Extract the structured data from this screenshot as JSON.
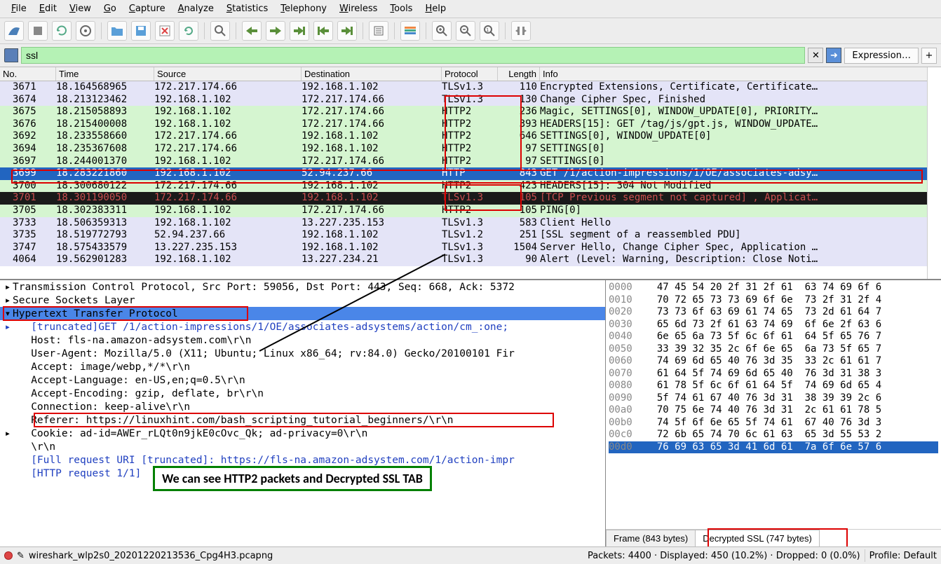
{
  "menu": [
    "File",
    "Edit",
    "View",
    "Go",
    "Capture",
    "Analyze",
    "Statistics",
    "Telephony",
    "Wireless",
    "Tools",
    "Help"
  ],
  "filter": {
    "value": "ssl",
    "expression_label": "Expression…"
  },
  "columns": {
    "no": "No.",
    "time": "Time",
    "source": "Source",
    "dest": "Destination",
    "proto": "Protocol",
    "len": "Length",
    "info": "Info"
  },
  "packets": [
    {
      "no": "3671",
      "time": "18.164568965",
      "src": "172.217.174.66",
      "dst": "192.168.1.102",
      "proto": "TLSv1.3",
      "len": "110",
      "info": "Encrypted Extensions, Certificate, Certificate…",
      "bg": "lavender"
    },
    {
      "no": "3674",
      "time": "18.213123462",
      "src": "192.168.1.102",
      "dst": "172.217.174.66",
      "proto": "TLSv1.3",
      "len": "130",
      "info": "Change Cipher Spec, Finished",
      "bg": "lavender"
    },
    {
      "no": "3675",
      "time": "18.215058893",
      "src": "192.168.1.102",
      "dst": "172.217.174.66",
      "proto": "HTTP2",
      "len": "236",
      "info": "Magic, SETTINGS[0], WINDOW_UPDATE[0], PRIORITY…",
      "bg": "green"
    },
    {
      "no": "3676",
      "time": "18.215400008",
      "src": "192.168.1.102",
      "dst": "172.217.174.66",
      "proto": "HTTP2",
      "len": "393",
      "info": "HEADERS[15]: GET /tag/js/gpt.js, WINDOW_UPDATE…",
      "bg": "green"
    },
    {
      "no": "3692",
      "time": "18.233558660",
      "src": "172.217.174.66",
      "dst": "192.168.1.102",
      "proto": "HTTP2",
      "len": "646",
      "info": "SETTINGS[0], WINDOW_UPDATE[0]",
      "bg": "green"
    },
    {
      "no": "3694",
      "time": "18.235367608",
      "src": "172.217.174.66",
      "dst": "192.168.1.102",
      "proto": "HTTP2",
      "len": "97",
      "info": "SETTINGS[0]",
      "bg": "green"
    },
    {
      "no": "3697",
      "time": "18.244001370",
      "src": "192.168.1.102",
      "dst": "172.217.174.66",
      "proto": "HTTP2",
      "len": "97",
      "info": "SETTINGS[0]",
      "bg": "green"
    },
    {
      "no": "3699",
      "time": "18.283221860",
      "src": "192.168.1.102",
      "dst": "52.94.237.66",
      "proto": "HTTP",
      "len": "843",
      "info": "GET /1/action-impressions/1/OE/associates-adsy…",
      "bg": "sel"
    },
    {
      "no": "3700",
      "time": "18.300680122",
      "src": "172.217.174.66",
      "dst": "192.168.1.102",
      "proto": "HTTP2",
      "len": "423",
      "info": "HEADERS[15]: 304 Not Modified",
      "bg": "green"
    },
    {
      "no": "3701",
      "time": "18.301190050",
      "src": "172.217.174.66",
      "dst": "192.168.1.102",
      "proto": "TLSv1.3",
      "len": "105",
      "info": "[TCP Previous segment not captured] , Applicat…",
      "bg": "dark"
    },
    {
      "no": "3705",
      "time": "18.302383311",
      "src": "192.168.1.102",
      "dst": "172.217.174.66",
      "proto": "HTTP2",
      "len": "105",
      "info": "PING[0]",
      "bg": "green"
    },
    {
      "no": "3733",
      "time": "18.506359313",
      "src": "192.168.1.102",
      "dst": "13.227.235.153",
      "proto": "TLSv1.3",
      "len": "583",
      "info": "Client Hello",
      "bg": "lavender"
    },
    {
      "no": "3735",
      "time": "18.519772793",
      "src": "52.94.237.66",
      "dst": "192.168.1.102",
      "proto": "TLSv1.2",
      "len": "251",
      "info": "[SSL segment of a reassembled PDU]",
      "bg": "lavender"
    },
    {
      "no": "3747",
      "time": "18.575433579",
      "src": "13.227.235.153",
      "dst": "192.168.1.102",
      "proto": "TLSv1.3",
      "len": "1504",
      "info": "Server Hello, Change Cipher Spec, Application …",
      "bg": "lavender"
    },
    {
      "no": "4064",
      "time": "19.562901283",
      "src": "192.168.1.102",
      "dst": "13.227.234.21",
      "proto": "TLSv1.3",
      "len": "90",
      "info": "Alert (Level: Warning, Description: Close Noti…",
      "bg": "lavender"
    }
  ],
  "details": [
    {
      "indent": 0,
      "arrow": "▸",
      "text": "Transmission Control Protocol, Src Port: 59056, Dst Port: 443, Seq: 668, Ack: 5372",
      "cls": ""
    },
    {
      "indent": 0,
      "arrow": "▸",
      "text": "Secure Sockets Layer",
      "cls": ""
    },
    {
      "indent": 0,
      "arrow": "▾",
      "text": "Hypertext Transfer Protocol",
      "cls": "detail-selected"
    },
    {
      "indent": 1,
      "arrow": "▸",
      "text": "[truncated]GET /1/action-impressions/1/OE/associates-adsystems/action/cm_:one;",
      "cls": "detail-blue"
    },
    {
      "indent": 1,
      "arrow": "",
      "text": "Host: fls-na.amazon-adsystem.com\\r\\n",
      "cls": ""
    },
    {
      "indent": 1,
      "arrow": "",
      "text": "User-Agent: Mozilla/5.0 (X11; Ubuntu; Linux x86_64; rv:84.0) Gecko/20100101 Fir",
      "cls": ""
    },
    {
      "indent": 1,
      "arrow": "",
      "text": "Accept: image/webp,*/*\\r\\n",
      "cls": ""
    },
    {
      "indent": 1,
      "arrow": "",
      "text": "Accept-Language: en-US,en;q=0.5\\r\\n",
      "cls": ""
    },
    {
      "indent": 1,
      "arrow": "",
      "text": "Accept-Encoding: gzip, deflate, br\\r\\n",
      "cls": ""
    },
    {
      "indent": 1,
      "arrow": "",
      "text": "Connection: keep-alive\\r\\n",
      "cls": ""
    },
    {
      "indent": 1,
      "arrow": "",
      "text": "Referer: https://linuxhint.com/bash_scripting_tutorial_beginners/\\r\\n",
      "cls": ""
    },
    {
      "indent": 1,
      "arrow": "▸",
      "text": "Cookie: ad-id=AWEr_rLQt0n9jkE0cOvc_Qk; ad-privacy=0\\r\\n",
      "cls": ""
    },
    {
      "indent": 1,
      "arrow": "",
      "text": "\\r\\n",
      "cls": ""
    },
    {
      "indent": 1,
      "arrow": "",
      "text": "[Full request URI [truncated]: https://fls-na.amazon-adsystem.com/1/action-impr",
      "cls": "detail-blue"
    },
    {
      "indent": 1,
      "arrow": "",
      "text": "[HTTP request 1/1]",
      "cls": "detail-blue"
    }
  ],
  "hex": [
    {
      "off": "0000",
      "b": "47 45 54 20 2f 31 2f 61  63 74 69 6f 6"
    },
    {
      "off": "0010",
      "b": "70 72 65 73 73 69 6f 6e  73 2f 31 2f 4"
    },
    {
      "off": "0020",
      "b": "73 73 6f 63 69 61 74 65  73 2d 61 64 7"
    },
    {
      "off": "0030",
      "b": "65 6d 73 2f 61 63 74 69  6f 6e 2f 63 6"
    },
    {
      "off": "0040",
      "b": "6e 65 6a 73 5f 6c 6f 61  64 5f 65 76 7"
    },
    {
      "off": "0050",
      "b": "33 39 32 35 2c 6f 6e 65  6a 73 5f 65 7"
    },
    {
      "off": "0060",
      "b": "74 69 6d 65 40 76 3d 35  33 2c 61 61 7"
    },
    {
      "off": "0070",
      "b": "61 64 5f 74 69 6d 65 40  76 3d 31 38 3"
    },
    {
      "off": "0080",
      "b": "61 78 5f 6c 6f 61 64 5f  74 69 6d 65 4"
    },
    {
      "off": "0090",
      "b": "5f 74 61 67 40 76 3d 31  38 39 39 2c 6"
    },
    {
      "off": "00a0",
      "b": "70 75 6e 74 40 76 3d 31  2c 61 61 78 5"
    },
    {
      "off": "00b0",
      "b": "74 5f 6f 6e 65 5f 74 61  67 40 76 3d 3"
    },
    {
      "off": "00c0",
      "b": "72 6b 65 74 70 6c 61 63  65 3d 55 53 2"
    },
    {
      "off": "00d0",
      "b": "76 69 63 65 3d 41 6d 61  7a 6f 6e 57 6",
      "hl": true
    }
  ],
  "hex_tabs": {
    "frame": "Frame (843 bytes)",
    "ssl": "Decrypted SSL (747 bytes)"
  },
  "status": {
    "file": "wireshark_wlp2s0_20201220213536_Cpg4H3.pcapng",
    "stats": "Packets: 4400 · Displayed: 450 (10.2%) · Dropped: 0 (0.0%)",
    "profile": "Profile: Default"
  },
  "annotation": "We can see HTTP2 packets and Decrypted SSL TAB"
}
